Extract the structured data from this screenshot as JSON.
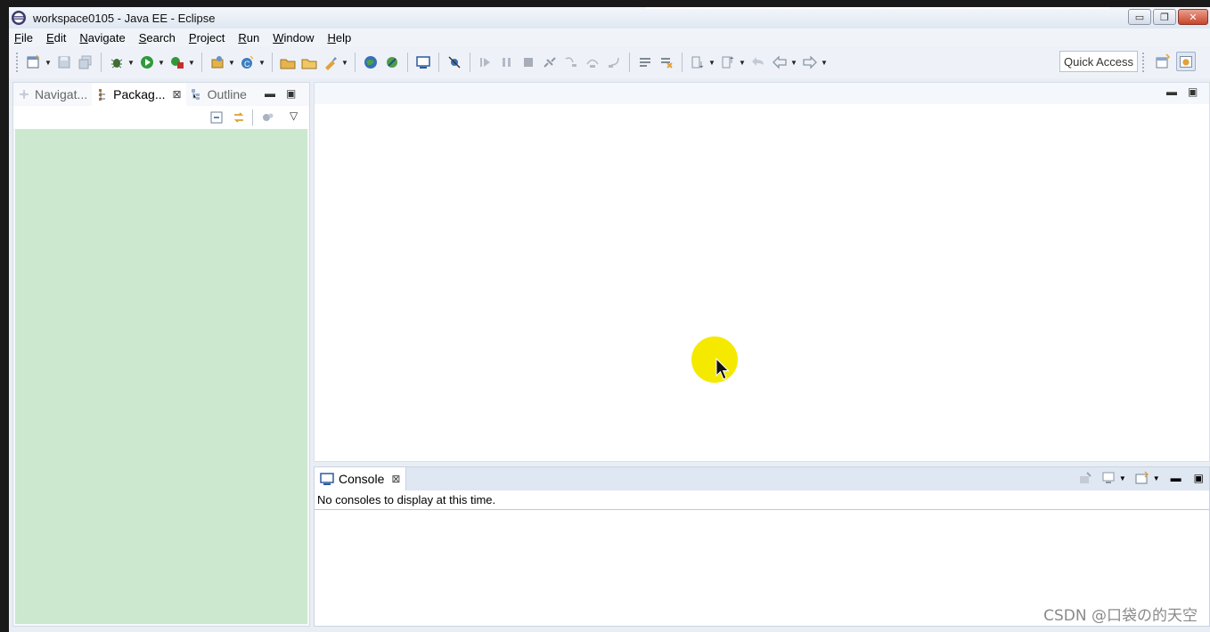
{
  "window": {
    "title": "workspace0105 - Java EE - Eclipse",
    "buttons": {
      "minimize": "▭",
      "restore": "❐",
      "close": "✕"
    }
  },
  "menu": {
    "items": [
      {
        "label": "File",
        "mnemonic": "F",
        "rest": "ile"
      },
      {
        "label": "Edit",
        "mnemonic": "E",
        "rest": "dit"
      },
      {
        "label": "Navigate",
        "mnemonic": "N",
        "rest": "avigate"
      },
      {
        "label": "Search",
        "mnemonic": "S",
        "rest": "earch",
        "pre": ""
      },
      {
        "label": "Project",
        "mnemonic": "P",
        "rest": "roject"
      },
      {
        "label": "Run",
        "mnemonic": "R",
        "rest": "un"
      },
      {
        "label": "Window",
        "mnemonic": "W",
        "rest": "indow"
      },
      {
        "label": "Help",
        "mnemonic": "H",
        "rest": "elp"
      }
    ]
  },
  "toolbar": {
    "quick_access": "Quick Access"
  },
  "left_panel": {
    "tabs": [
      {
        "label": "Navigat...",
        "icon": "navigator-icon"
      },
      {
        "label": "Packag...",
        "icon": "package-explorer-icon",
        "close": "⊠"
      },
      {
        "label": "Outline",
        "icon": "outline-icon"
      }
    ],
    "minimize": "▬",
    "maximize": "▣",
    "menu": "▽"
  },
  "editor": {
    "minimize": "▬",
    "maximize": "▣"
  },
  "console": {
    "tab_label": "Console",
    "close": "⊠",
    "message": "No consoles to display at this time.",
    "minimize": "▬",
    "maximize": "▣"
  },
  "watermark": "CSDN @口袋の的天空",
  "colors": {
    "tree_background": "#cce8cf",
    "highlight": "#f5e900"
  }
}
